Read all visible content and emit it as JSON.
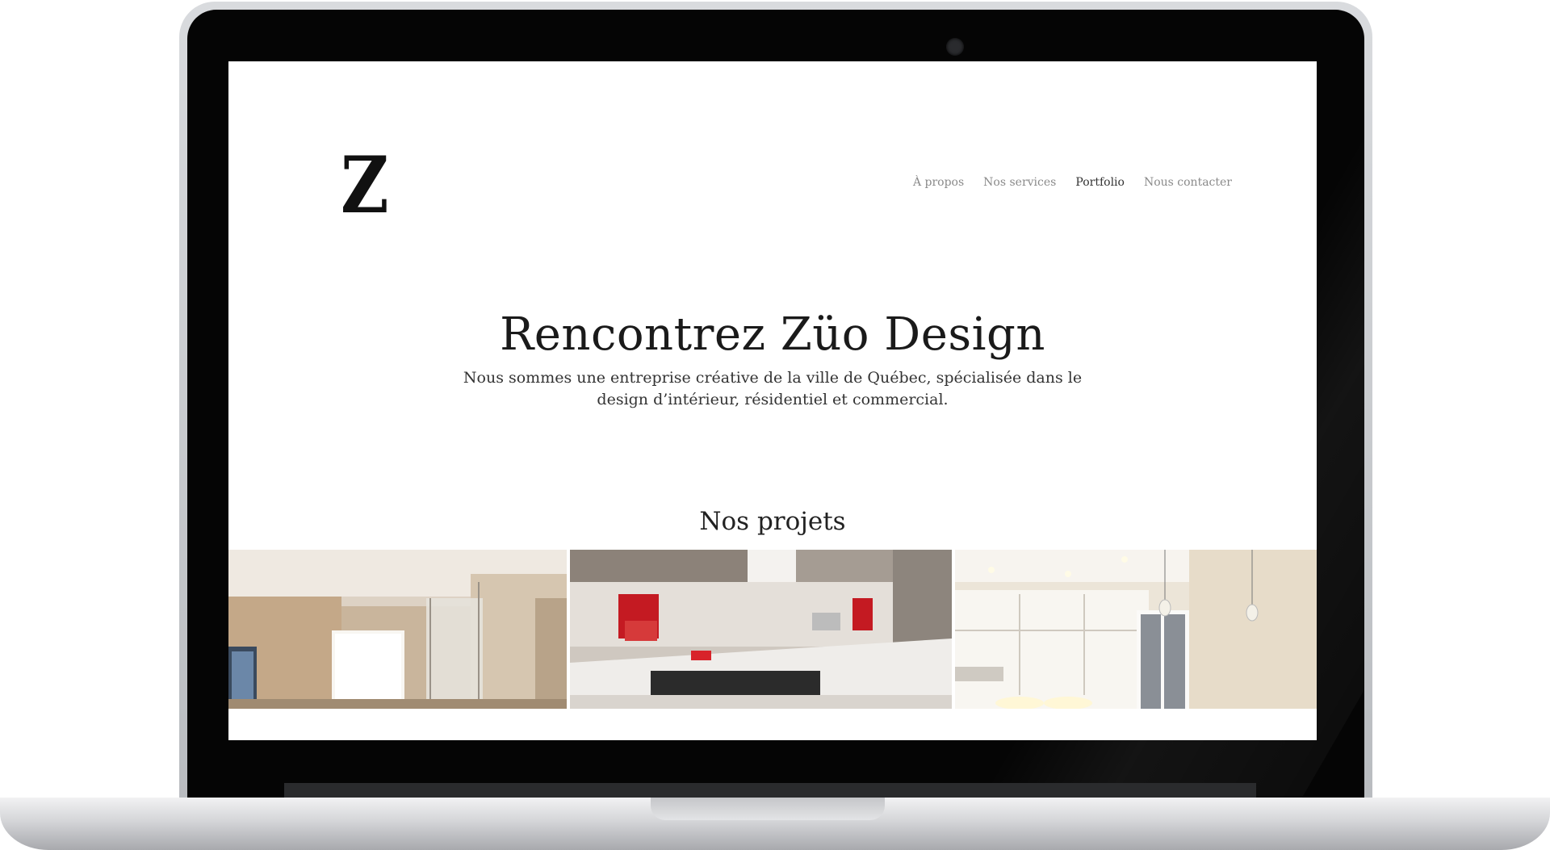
{
  "site": {
    "logo_text": "Z",
    "nav": [
      {
        "label": "À propos",
        "active": false
      },
      {
        "label": "Nos services",
        "active": false
      },
      {
        "label": "Portfolio",
        "active": true
      },
      {
        "label": "Nous contacter",
        "active": false
      }
    ],
    "hero": {
      "title": "Rencontrez Züo Design",
      "subtitle": "Nous sommes une entreprise créative de la ville de Québec, spécialisée dans le design d’intérieur, résidentiel et commercial."
    },
    "projects_section": {
      "title": "Nos projets",
      "items": [
        {
          "icon": "bathroom-photo"
        },
        {
          "icon": "kitchen-mixer-photo"
        },
        {
          "icon": "kitchen-cabinets-photo"
        }
      ]
    }
  },
  "colors": {
    "page_bg": "#ffffff",
    "text": "#1a1a1a",
    "nav_text": "#8a8a8a",
    "nav_active": "#333333",
    "bezel": "#050505",
    "accent_red": "#c8102e"
  }
}
